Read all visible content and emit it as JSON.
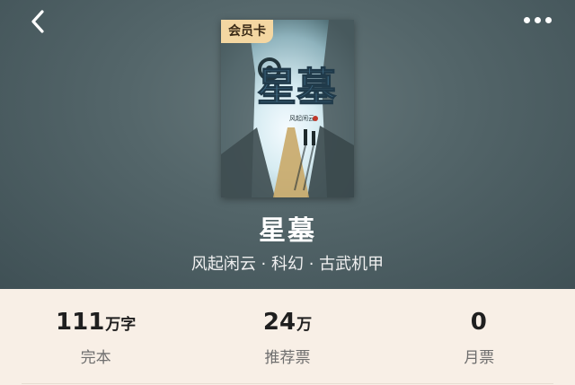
{
  "header": {
    "back_icon": "chevron-left-icon",
    "more_icon": "more-horizontal-icon"
  },
  "book": {
    "badge": "会员卡",
    "cover_title": "星墓",
    "title": "星墓",
    "meta": "风起闲云 · 科幻 · 古武机甲"
  },
  "stats": [
    {
      "value": "111",
      "unit": "万字",
      "label": "完本"
    },
    {
      "value": "24",
      "unit": "万",
      "label": "推荐票"
    },
    {
      "value": "0",
      "unit": "",
      "label": "月票"
    }
  ],
  "colors": {
    "hero_bg": "#54666a",
    "stats_bg": "#f8efe6",
    "badge_bg": "#f4d7a2"
  }
}
